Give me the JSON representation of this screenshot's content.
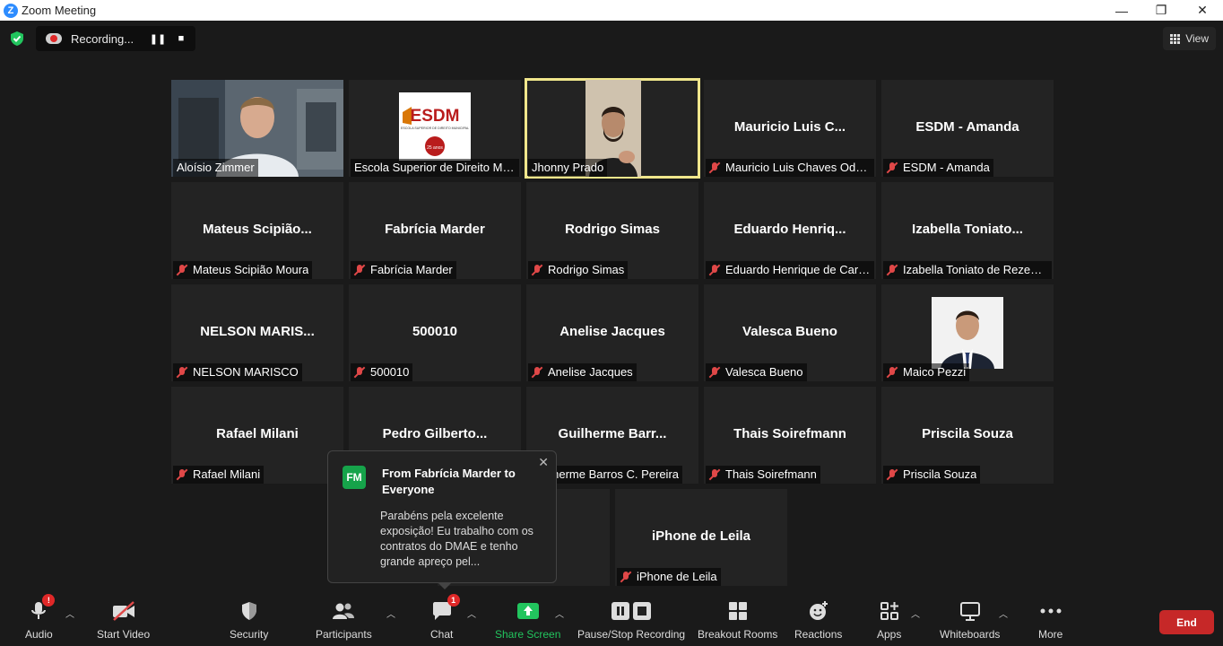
{
  "window": {
    "title": "Zoom Meeting",
    "logo_letter": "Z"
  },
  "recording": {
    "label": "Recording..."
  },
  "view": {
    "label": "View"
  },
  "tiles": [
    {
      "big": "",
      "name": "Aloísio Zimmer",
      "muted": false,
      "video": "person"
    },
    {
      "big": "",
      "name": "Escola Superior de Direito Municipal",
      "muted": false,
      "video": "logo"
    },
    {
      "big": "",
      "name": "Jhonny Prado",
      "muted": false,
      "video": "speaker",
      "active": true
    },
    {
      "big": "Mauricio Luis C...",
      "name": "Mauricio Luis Chaves Odorissi",
      "muted": true
    },
    {
      "big": "ESDM - Amanda",
      "name": "ESDM - Amanda",
      "muted": true
    },
    {
      "big": "Mateus Scipião...",
      "name": "Mateus Scipião Moura",
      "muted": true
    },
    {
      "big": "Fabrícia Marder",
      "name": "Fabrícia Marder",
      "muted": true
    },
    {
      "big": "Rodrigo Simas",
      "name": "Rodrigo Simas",
      "muted": true
    },
    {
      "big": "Eduardo Henriq...",
      "name": "Eduardo Henrique de Carvalho",
      "muted": true
    },
    {
      "big": "Izabella Toniato...",
      "name": "Izabella Toniato de Rezende",
      "muted": true
    },
    {
      "big": "NELSON MARIS...",
      "name": "NELSON MARISCO",
      "muted": true
    },
    {
      "big": "500010",
      "name": "500010",
      "muted": true
    },
    {
      "big": "Anelise Jacques",
      "name": "Anelise Jacques",
      "muted": true
    },
    {
      "big": "Valesca Bueno",
      "name": "Valesca Bueno",
      "muted": true
    },
    {
      "big": "",
      "name": "Maico Pezzi",
      "muted": true,
      "video": "photo"
    },
    {
      "big": "Rafael Milani",
      "name": "Rafael Milani",
      "muted": true
    },
    {
      "big": "Pedro Gilberto...",
      "name": "",
      "muted": false
    },
    {
      "big": "Guilherme Barr...",
      "name": "Guilherme Barros C. Pereira",
      "muted": false
    },
    {
      "big": "Thais Soirefmann",
      "name": "Thais Soirefmann",
      "muted": true
    },
    {
      "big": "Priscila Souza",
      "name": "Priscila Souza",
      "muted": true
    },
    {
      "big": "",
      "name": "",
      "muted": false
    },
    {
      "big": "iPhone de Leila",
      "name": "iPhone de Leila",
      "muted": true
    }
  ],
  "logo_tile": {
    "text": "ESDM",
    "subtitle": "ESCOLA SUPERIOR DE DIREITO MUNICIPAL",
    "seal": "25 anos"
  },
  "chat_toast": {
    "initials": "FM",
    "from": "From Fabrícia Marder to Everyone",
    "message": "Parabéns pela excelente exposição! Eu trabalho com os contratos do DMAE e tenho grande apreço pel..."
  },
  "toolbar": {
    "audio": "Audio",
    "audio_badge": "!",
    "start_video": "Start Video",
    "security": "Security",
    "participants": "Participants",
    "chat": "Chat",
    "chat_badge": "1",
    "share_screen": "Share Screen",
    "recording": "Pause/Stop Recording",
    "breakout": "Breakout Rooms",
    "reactions": "Reactions",
    "apps": "Apps",
    "whiteboards": "Whiteboards",
    "more": "More",
    "end": "End"
  },
  "colors": {
    "accent": "#2d8cff",
    "share_green": "#22c55e",
    "end_red": "#c62828",
    "active_border": "#f0e68c",
    "mute_red": "#e04848"
  }
}
